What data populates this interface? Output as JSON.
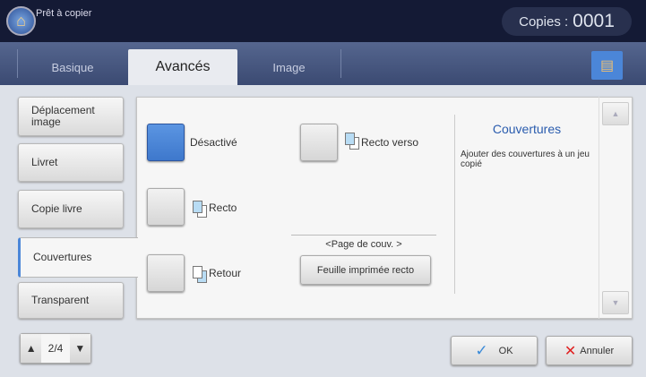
{
  "header": {
    "status": "Prêt à copier",
    "copies_label": "Copies :",
    "copies_value": "0001"
  },
  "tabs": [
    {
      "label": "Basique"
    },
    {
      "label": "Avancés",
      "active": true
    },
    {
      "label": "Image"
    }
  ],
  "sidebar": [
    {
      "label": "Déplacement image"
    },
    {
      "label": "Livret"
    },
    {
      "label": "Copie livre"
    },
    {
      "label": "Couvertures",
      "active": true
    },
    {
      "label": "Transparent"
    }
  ],
  "options": {
    "disabled": "Désactivé",
    "duplex": "Recto verso",
    "front": "Recto",
    "back": "Retour",
    "selected": "Désactivé"
  },
  "cover_page": {
    "label": "<Page de couv. >",
    "button": "Feuille imprimée recto"
  },
  "info": {
    "title": "Couvertures",
    "description": "Ajouter des couvertures à un jeu copié"
  },
  "pager": {
    "value": "2/4"
  },
  "actions": {
    "ok": "OK",
    "cancel": "Annuler"
  },
  "colors": {
    "accent": "#4b86d8",
    "header": "#141a35"
  }
}
